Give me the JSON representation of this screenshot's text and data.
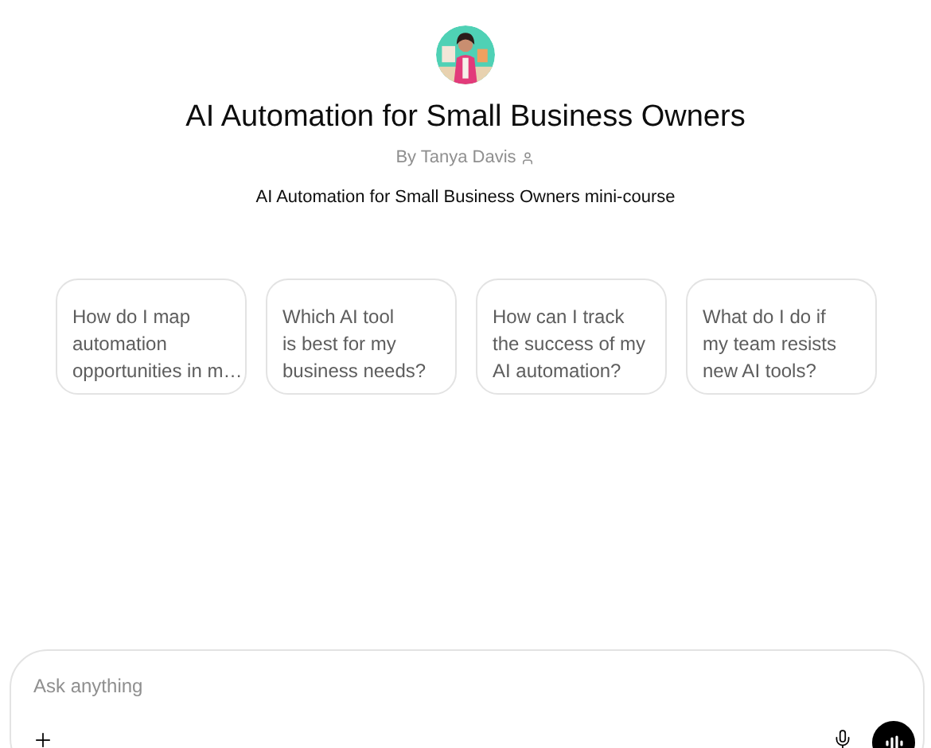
{
  "header": {
    "title": "AI Automation for Small Business Owners",
    "author": "By Tanya Davis",
    "description": "AI Automation for Small Business Owners mini-course"
  },
  "suggestions": [
    {
      "lines": [
        "How do I map",
        "automation",
        "opportunities in m…"
      ]
    },
    {
      "lines": [
        "Which AI tool",
        "is best for my",
        "business needs?"
      ]
    },
    {
      "lines": [
        "How can I track",
        "the success of my",
        "AI automation?"
      ]
    },
    {
      "lines": [
        "What do I do if",
        "my team resists",
        "new AI tools?"
      ]
    }
  ],
  "composer": {
    "placeholder": "Ask anything"
  }
}
